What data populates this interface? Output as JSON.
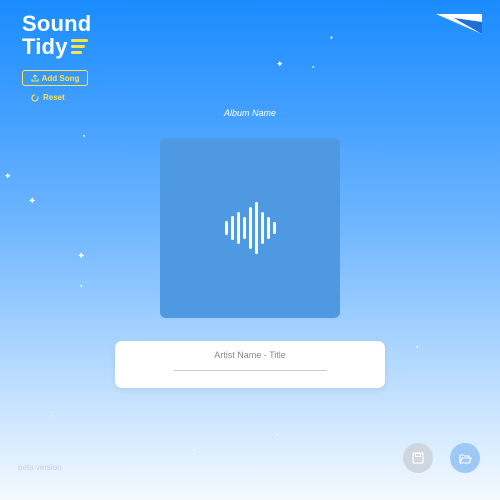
{
  "app": {
    "logo_line1": "Sound",
    "logo_line2": "Tidy"
  },
  "toolbar": {
    "add_song_label": "Add Song",
    "reset_label": "Reset"
  },
  "album": {
    "name": "Album Name"
  },
  "track": {
    "display": "Artist Name - Title"
  },
  "footer": {
    "version_label": "beta version"
  },
  "colors": {
    "accent": "#ffe24a",
    "cover": "#4f98e2"
  },
  "icons": [
    "upload-icon",
    "reset-icon",
    "soundwave-icon",
    "save-icon",
    "folder-open-icon",
    "corner-fold-icon"
  ]
}
